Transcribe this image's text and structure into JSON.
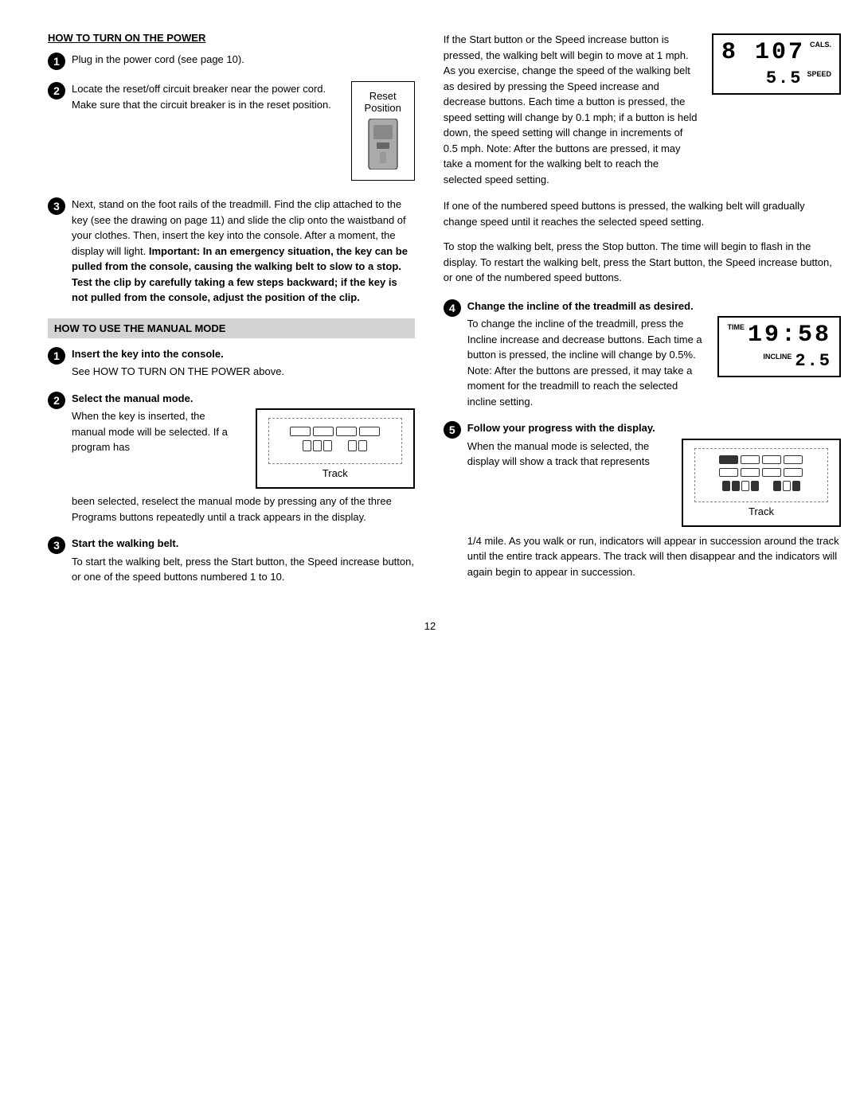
{
  "page": {
    "number": "12"
  },
  "section1": {
    "header": "HOW TO TURN ON THE POWER",
    "step1": {
      "text": "Plug in the power cord (see page 10)."
    },
    "step2": {
      "text": "Locate the reset/off circuit breaker near the power cord. Make sure that the circuit breaker is in the reset position.",
      "diagram_label1": "Reset",
      "diagram_label2": "Position"
    },
    "step3": {
      "text_normal": "Next, stand on the foot rails of the treadmill. Find the clip attached to the key (see the drawing on page 11) and slide the clip onto the waistband of your clothes. Then, insert the key into the console. After a moment, the display will light. ",
      "important_label": "Important:",
      "text_bold": "In an emergency situation, the key can be pulled from the console, causing the walking belt to slow to a stop. Test the clip by carefully taking a few steps backward; if the key is not pulled from the console, adjust the position of the clip."
    }
  },
  "section2": {
    "header": "HOW TO USE THE MANUAL MODE",
    "step1": {
      "title": "Insert the key into the console.",
      "text": "See HOW TO TURN ON THE POWER above."
    },
    "step2": {
      "title": "Select the manual mode.",
      "text_before": "When the key is inserted, the manual mode will be selected. If a program has",
      "text_after": "been selected, reselect the manual mode by pressing any of the three Programs buttons repeatedly until a track appears in the display.",
      "track_label": "Track"
    },
    "step3": {
      "title": "Start the walking belt.",
      "text": "To start the walking belt, press the Start button, the Speed increase button, or one of the speed buttons numbered 1 to 10."
    }
  },
  "right_col": {
    "para1": "If the Start button or the Speed increase button is pressed, the walking belt will begin to move at 1 mph. As you exercise, change the speed of the walking belt as desired by pressing the Speed increase and decrease buttons. Each time a button is pressed, the speed setting will change by 0.1 mph; if a button is held down, the speed setting will change in increments of 0.5 mph. Note: After the buttons are pressed, it may take a moment for the walking belt to reach the selected speed setting.",
    "display1": {
      "row1_num": "8 107",
      "row1_label": "CALS.",
      "row2_num": "5.5",
      "row2_label": "SPEED"
    },
    "para2": "If one of the numbered speed buttons is pressed, the walking belt will gradually change speed until it reaches the selected speed setting.",
    "para3": "To stop the walking belt, press the Stop button. The time will begin to flash in the display. To restart the walking belt, press the Start button, the Speed increase button, or one of the numbered speed buttons.",
    "step4": {
      "title": "Change the incline of the treadmill as desired.",
      "text": "To change the incline of the treadmill, press the Incline increase and decrease buttons. Each time a button is pressed, the incline will change by 0.5%. Note: After the buttons are pressed, it may take a moment for the treadmill to reach the selected incline setting.",
      "display": {
        "row1_label": "TIME",
        "row1_num": "19:58",
        "row2_label": "INCLINE",
        "row2_num": "2.5"
      }
    },
    "step5": {
      "title": "Follow your progress with the display.",
      "text_before": "When the manual mode is selected, the display will show a track that represents",
      "text_after": "1/4 mile. As you walk or run, indicators will appear in succession around the track until the entire track appears. The track will then disappear and the indicators will again begin to appear in succession.",
      "track_label": "Track"
    }
  }
}
